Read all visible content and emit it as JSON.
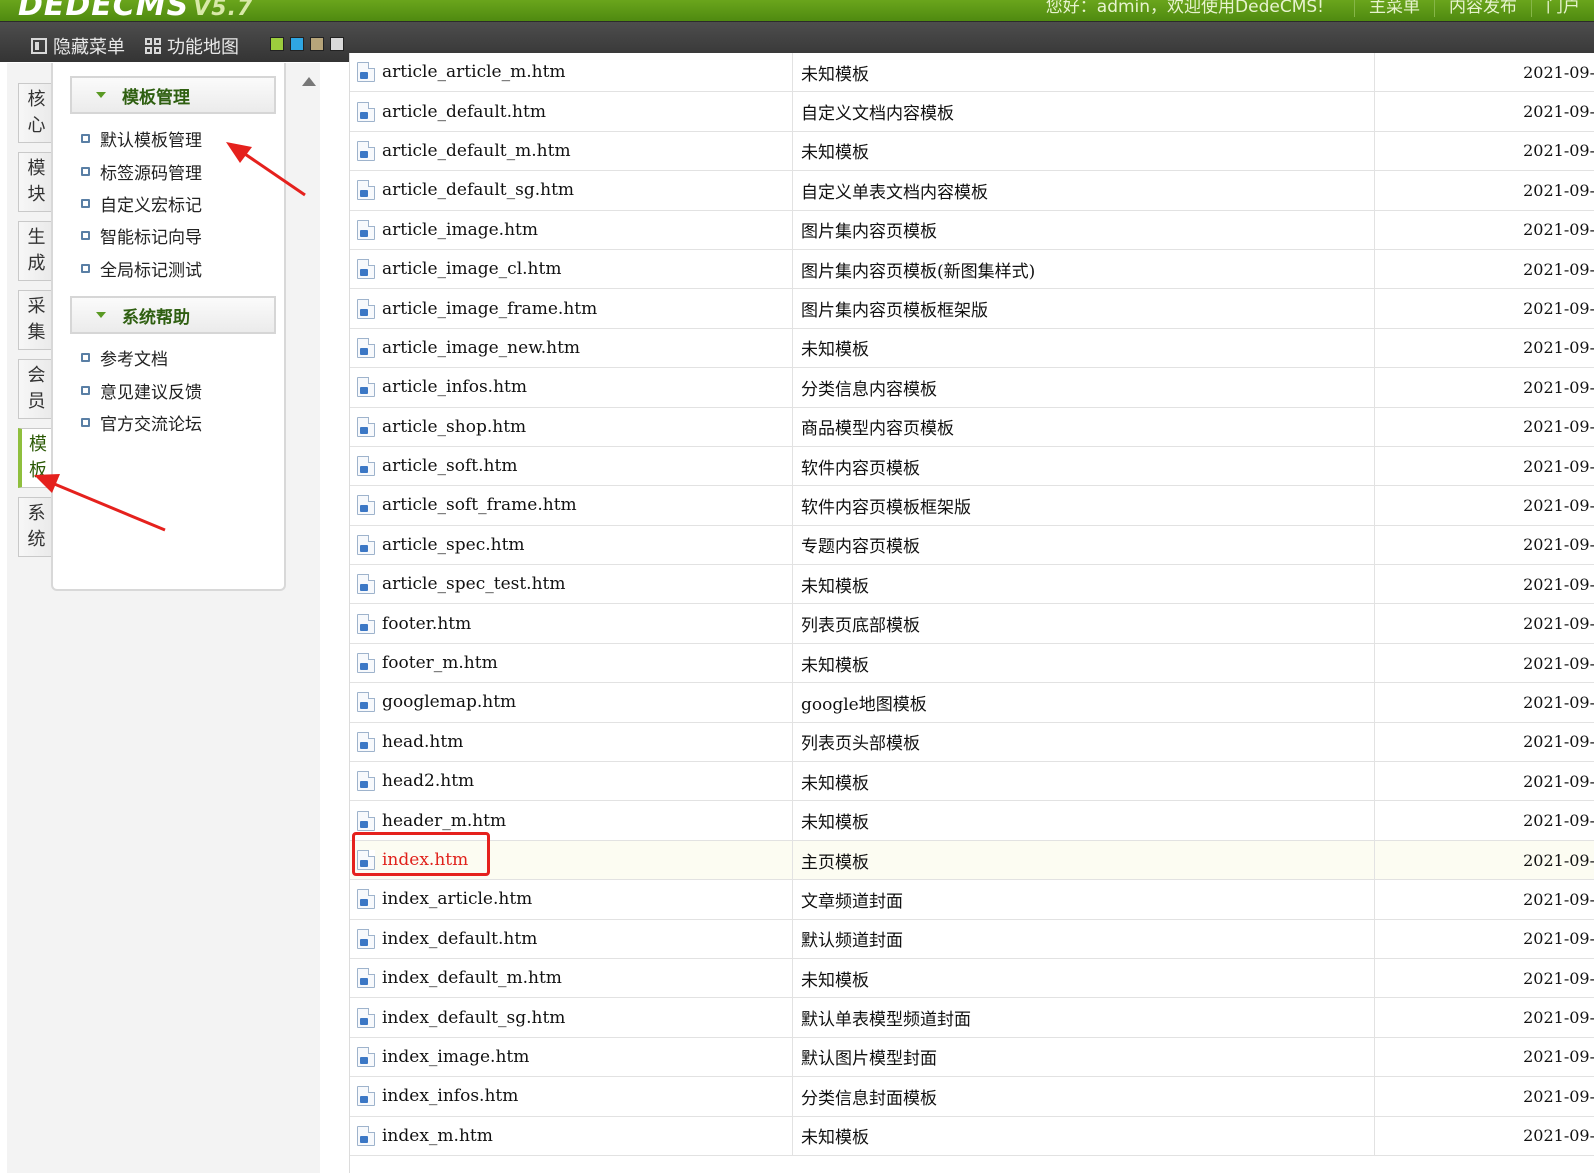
{
  "header": {
    "logo_text": "DEDECMS",
    "version": "V5.7",
    "welcome": "您好：admin，欢迎使用DedeCMS!",
    "links": [
      "主菜单",
      "内容发布",
      "门户"
    ]
  },
  "toolbar": {
    "hide_menu": "隐藏菜单",
    "site_map": "功能地图",
    "skin_colors": [
      "#9ccd3d",
      "#2fa6e3",
      "#b7a57a",
      "#d9d9d9"
    ]
  },
  "side_tabs": [
    "核心",
    "模块",
    "生成",
    "采集",
    "会员",
    "模板",
    "系统"
  ],
  "active_tab": "模板",
  "menu": {
    "groups": [
      {
        "title": "模板管理",
        "items": [
          "默认模板管理",
          "标签源码管理",
          "自定义宏标记",
          "智能标记向导",
          "全局标记测试"
        ]
      },
      {
        "title": "系统帮助",
        "items": [
          "参考文档",
          "意见建议反馈",
          "官方交流论坛"
        ]
      }
    ]
  },
  "templates": [
    {
      "name": "article_article_m.htm",
      "desc": "未知模板",
      "date": "2021-09-"
    },
    {
      "name": "article_default.htm",
      "desc": "自定义文档内容模板",
      "date": "2021-09-"
    },
    {
      "name": "article_default_m.htm",
      "desc": "未知模板",
      "date": "2021-09-"
    },
    {
      "name": "article_default_sg.htm",
      "desc": "自定义单表文档内容模板",
      "date": "2021-09-"
    },
    {
      "name": "article_image.htm",
      "desc": "图片集内容页模板",
      "date": "2021-09-"
    },
    {
      "name": "article_image_cl.htm",
      "desc": "图片集内容页模板(新图集样式)",
      "date": "2021-09-"
    },
    {
      "name": "article_image_frame.htm",
      "desc": "图片集内容页模板框架版",
      "date": "2021-09-"
    },
    {
      "name": "article_image_new.htm",
      "desc": "未知模板",
      "date": "2021-09-"
    },
    {
      "name": "article_infos.htm",
      "desc": "分类信息内容模板",
      "date": "2021-09-"
    },
    {
      "name": "article_shop.htm",
      "desc": "商品模型内容页模板",
      "date": "2021-09-"
    },
    {
      "name": "article_soft.htm",
      "desc": "软件内容页模板",
      "date": "2021-09-"
    },
    {
      "name": "article_soft_frame.htm",
      "desc": "软件内容页模板框架版",
      "date": "2021-09-"
    },
    {
      "name": "article_spec.htm",
      "desc": "专题内容页模板",
      "date": "2021-09-"
    },
    {
      "name": "article_spec_test.htm",
      "desc": "未知模板",
      "date": "2021-09-"
    },
    {
      "name": "footer.htm",
      "desc": "列表页底部模板",
      "date": "2021-09-"
    },
    {
      "name": "footer_m.htm",
      "desc": "未知模板",
      "date": "2021-09-"
    },
    {
      "name": "googlemap.htm",
      "desc": "google地图模板",
      "date": "2021-09-"
    },
    {
      "name": "head.htm",
      "desc": "列表页头部模板",
      "date": "2021-09-"
    },
    {
      "name": "head2.htm",
      "desc": "未知模板",
      "date": "2021-09-"
    },
    {
      "name": "header_m.htm",
      "desc": "未知模板",
      "date": "2021-09-"
    },
    {
      "name": "index.htm",
      "desc": "主页模板",
      "date": "2021-09-"
    },
    {
      "name": "index_article.htm",
      "desc": "文章频道封面",
      "date": "2021-09-"
    },
    {
      "name": "index_default.htm",
      "desc": "默认频道封面",
      "date": "2021-09-"
    },
    {
      "name": "index_default_m.htm",
      "desc": "未知模板",
      "date": "2021-09-"
    },
    {
      "name": "index_default_sg.htm",
      "desc": "默认单表模型频道封面",
      "date": "2021-09-"
    },
    {
      "name": "index_image.htm",
      "desc": "默认图片模型封面",
      "date": "2021-09-"
    },
    {
      "name": "index_infos.htm",
      "desc": "分类信息封面模板",
      "date": "2021-09-"
    },
    {
      "name": "index_m.htm",
      "desc": "未知模板",
      "date": "2021-09-"
    }
  ],
  "highlighted_template": "index.htm",
  "annotation_color": "#e5211d"
}
